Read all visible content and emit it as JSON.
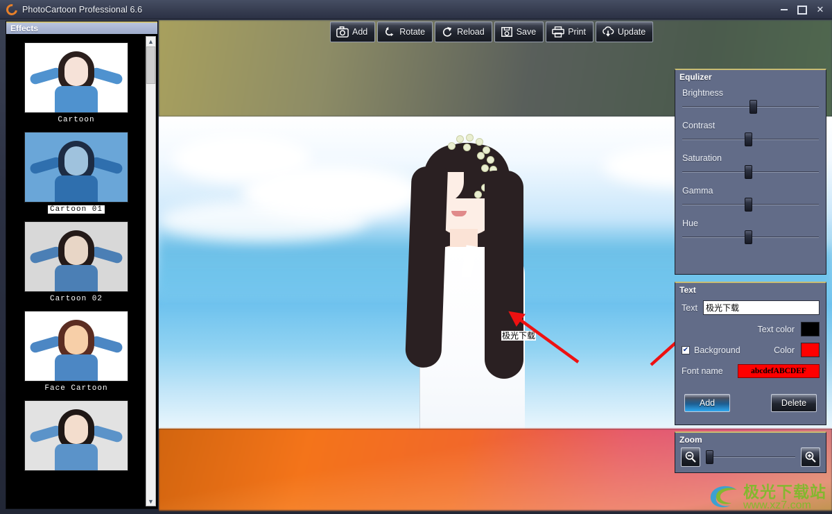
{
  "window": {
    "title": "PhotoCartoon Professional 6.6",
    "icon": "app-logo-icon",
    "minimize": "−",
    "maximize": "□",
    "close": "✕"
  },
  "effects": {
    "header": "Effects",
    "items": [
      {
        "label": "Cartoon",
        "selected": false,
        "bg": "#ffffff",
        "skin": "#f6e2d8",
        "cloth": "#4f92cf",
        "hair": "#2b1f1d"
      },
      {
        "label": "Cartoon 01",
        "selected": true,
        "bg": "#6aa6d8",
        "skin": "#9fc2dd",
        "cloth": "#2f6fae",
        "hair": "#1d2c44"
      },
      {
        "label": "Cartoon 02",
        "selected": false,
        "bg": "#d8d8d8",
        "skin": "#e8d6c6",
        "cloth": "#4b7fb5",
        "hair": "#241a18"
      },
      {
        "label": "Face Cartoon",
        "selected": false,
        "bg": "#ffffff",
        "skin": "#f7cfa8",
        "cloth": "#4c87c4",
        "hair": "#5b2d22"
      },
      {
        "label": "",
        "selected": false,
        "bg": "#e2e2e2",
        "skin": "#f3ddcd",
        "cloth": "#5b93c9",
        "hair": "#1f1715"
      }
    ],
    "scrollbar": {
      "up": "︿",
      "down": "﹀"
    }
  },
  "toolbar": {
    "buttons": [
      {
        "label": "Add",
        "icon": "camera-icon"
      },
      {
        "label": "Rotate",
        "icon": "rotate-icon"
      },
      {
        "label": "Reload",
        "icon": "reload-icon"
      },
      {
        "label": "Save",
        "icon": "floppy-disk-icon"
      },
      {
        "label": "Print",
        "icon": "printer-icon"
      },
      {
        "label": "Update",
        "icon": "cloud-download-icon"
      }
    ]
  },
  "canvas": {
    "overlay_text": "极光下载"
  },
  "equalizer": {
    "title": "Equlizer",
    "sliders": [
      {
        "label": "Brightness",
        "value": 52
      },
      {
        "label": "Contrast",
        "value": 48
      },
      {
        "label": "Saturation",
        "value": 48
      },
      {
        "label": "Gamma",
        "value": 48
      },
      {
        "label": "Hue",
        "value": 48
      }
    ]
  },
  "text_panel": {
    "title": "Text",
    "text_label": "Text",
    "text_value": "极光下载",
    "text_color_label": "Text color",
    "text_color": "#000000",
    "background_label": "Background",
    "background_checked": true,
    "color_label": "Color",
    "color": "#ff0000",
    "font_name_label": "Font name",
    "font_sample": "abcdefABCDEF",
    "add_label": "Add",
    "delete_label": "Delete"
  },
  "zoom_panel": {
    "title": "Zoom",
    "zoom_out_icon": "magnifier-minus-icon",
    "zoom_in_icon": "magnifier-plus-icon",
    "value": 2
  },
  "watermark": {
    "cn": "极光下载站",
    "url": "www.xz7.com"
  }
}
